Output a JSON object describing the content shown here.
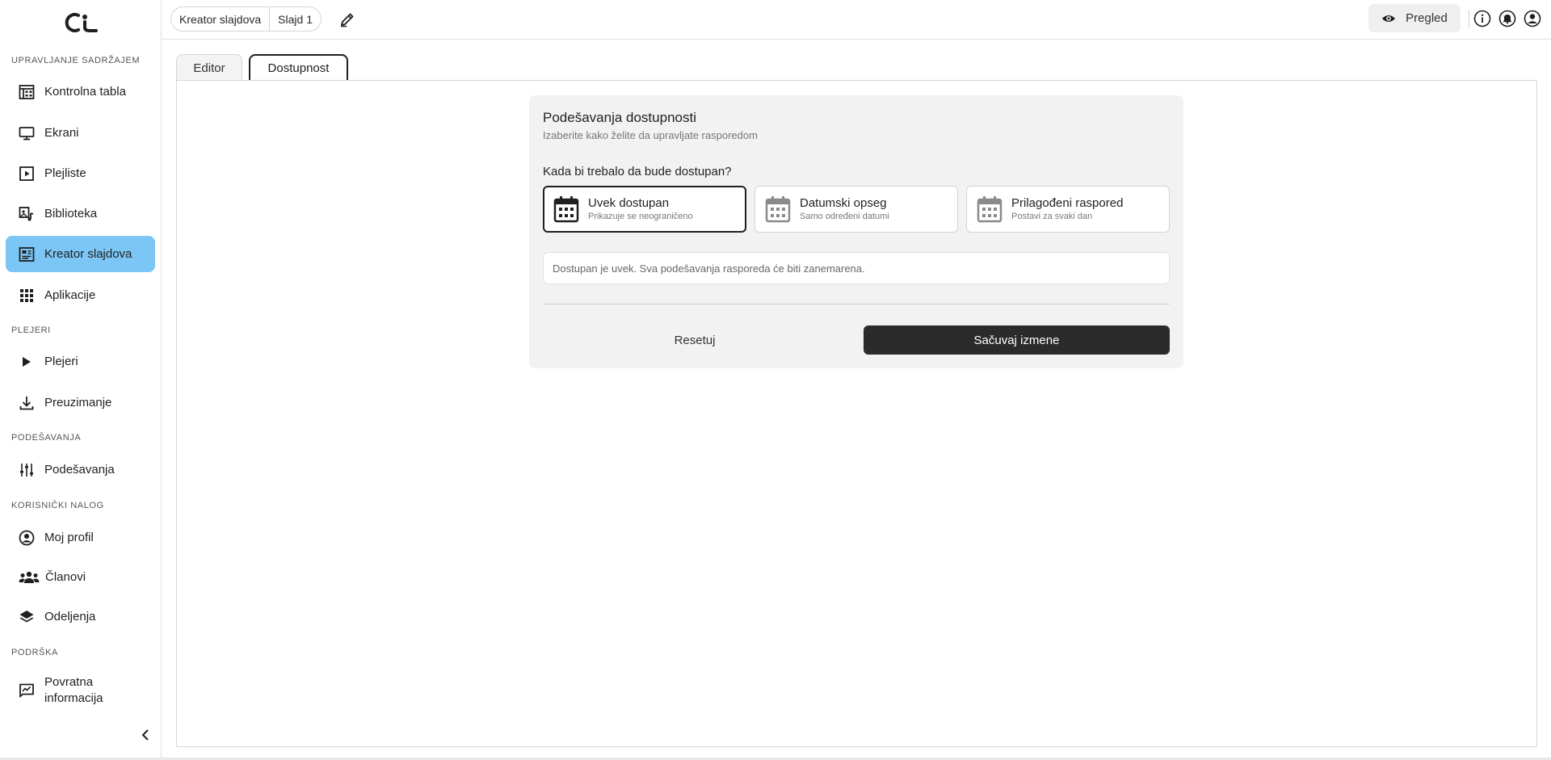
{
  "sidebar": {
    "sections": {
      "content": "UPRAVLJANJE SADRŽAJEM",
      "players": "PLEJERI",
      "settings": "PODEŠAVANJA",
      "account": "KORISNIČKI NALOG",
      "support": "PODRŠKA"
    },
    "items": {
      "dashboard": "Kontrolna tabla",
      "screens": "Ekrani",
      "playlists": "Plejliste",
      "library": "Biblioteka",
      "slide_creator": "Kreator slajdova",
      "apps": "Aplikacije",
      "players": "Plejeri",
      "downloads": "Preuzimanje",
      "settings": "Podešavanja",
      "profile": "Moj profil",
      "members": "Članovi",
      "departments": "Odeljenja",
      "feedback_line1": "Povratna",
      "feedback_line2": "informacija"
    },
    "active_item": "slide_creator",
    "active_color": "#7cc6f5"
  },
  "topbar": {
    "breadcrumb": [
      "Kreator slajdova",
      "Slajd 1"
    ],
    "preview_label": "Pregled",
    "icons": [
      "edit-icon",
      "eye-icon",
      "info-icon",
      "bell-icon",
      "account-icon"
    ]
  },
  "tabs": {
    "editor": "Editor",
    "availability": "Dostupnost",
    "active": "availability"
  },
  "availability": {
    "title": "Podešavanja dostupnosti",
    "subtitle": "Izaberite kako želite da upravljate rasporedom",
    "question": "Kada bi trebalo da bude dostupan?",
    "options": [
      {
        "title": "Uvek dostupan",
        "subtitle": "Prikazuje se neograničeno",
        "selected": true
      },
      {
        "title": "Datumski opseg",
        "subtitle": "Samo određeni datumi",
        "selected": false
      },
      {
        "title": "Prilagođeni raspored",
        "subtitle": "Postavi za svaki dan",
        "selected": false
      }
    ],
    "info": "Dostupan je uvek. Sva podešavanja rasporeda će biti zanemarena.",
    "reset_label": "Resetuj",
    "save_label": "Sačuvaj izmene",
    "save_color": "#2b2b2b"
  }
}
